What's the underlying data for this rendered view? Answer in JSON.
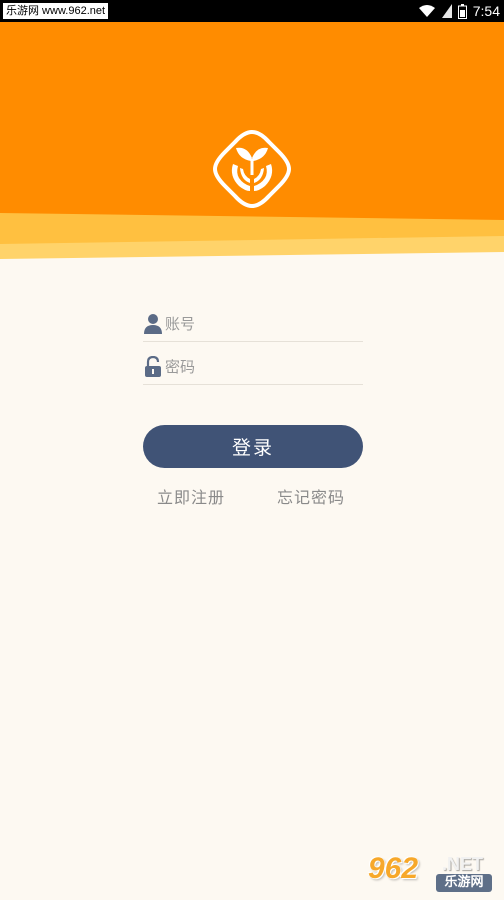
{
  "status_bar": {
    "watermark": "乐游网 www.962.net",
    "time": "7:54",
    "icons": [
      "wifi-icon",
      "signal-icon",
      "battery-icon"
    ]
  },
  "header": {
    "logo_icon": "seedling-in-hands-logo",
    "colors": {
      "primary": "#ff8c00",
      "wave_light": "#ffd36a",
      "wave_mid": "#ffc040"
    }
  },
  "form": {
    "account": {
      "icon": "user-icon",
      "placeholder": "账号",
      "value": ""
    },
    "password": {
      "icon": "lock-icon",
      "placeholder": "密码",
      "value": ""
    },
    "login_label": "登录",
    "register_label": "立即注册",
    "forgot_label": "忘记密码"
  },
  "watermark_bottom": {
    "number": "962",
    "net": ".NET",
    "cn": "乐游网"
  },
  "colors": {
    "background": "#fdf9f2",
    "button": "#405376",
    "icon": "#5b6b86",
    "link": "#8a8a8a"
  }
}
